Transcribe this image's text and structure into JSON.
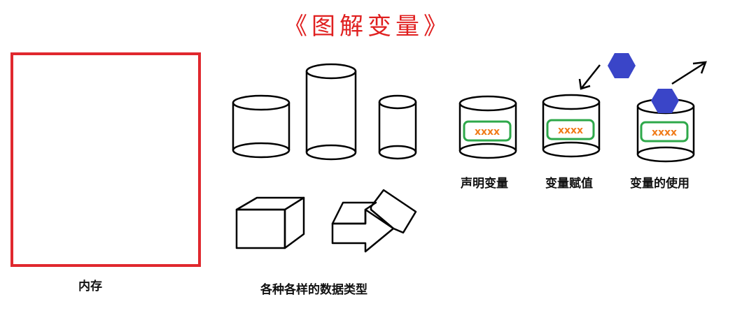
{
  "title": "《图解变量》",
  "labels": {
    "memory": "内存",
    "data_types": "各种各样的数据类型",
    "declare": "声明变量",
    "assign": "变量赋值",
    "use": "变量的使用"
  },
  "placeholder_text": "xxxx",
  "colors": {
    "title": "#e02020",
    "memory_border": "#e0282e",
    "label_border": "#2ea84a",
    "placeholder_text": "#f07c1a",
    "hexagon": "#3a45c8",
    "stroke": "#000000"
  }
}
